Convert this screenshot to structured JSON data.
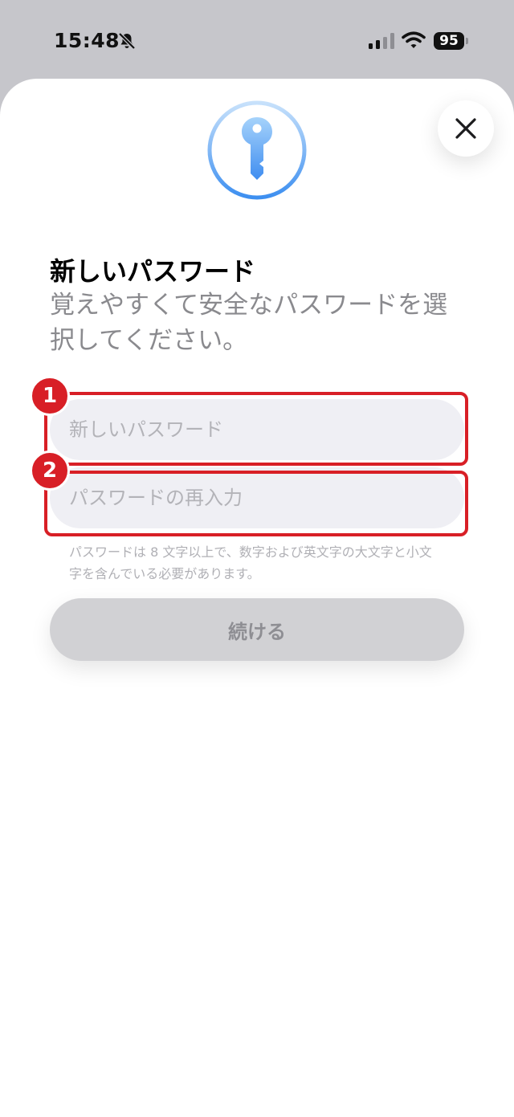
{
  "status_bar": {
    "time": "15:48",
    "battery": "95"
  },
  "icons": {
    "bell": "bell-slash-icon",
    "signal": "cellular-signal-icon",
    "wifi": "wifi-icon",
    "key": "key-icon",
    "close": "close-icon"
  },
  "colors": {
    "accent_blue": "#3d8ff0",
    "marker_red": "#d81f26",
    "button_disabled": "#d1d1d4",
    "field_bg": "#efeff4"
  },
  "sheet": {
    "title": "新しいパスワード",
    "subtitle": "覚えやすくて安全なパスワードを選択してください。",
    "new_password_placeholder": "新しいパスワード",
    "confirm_password_placeholder": "パスワードの再入力",
    "hint": "パスワードは 8 文字以上で、数字および英文字の大文字と小文字を含んでいる必要があります。",
    "continue_label": "続ける"
  },
  "annotations": {
    "marker_1": "1",
    "marker_2": "2"
  }
}
